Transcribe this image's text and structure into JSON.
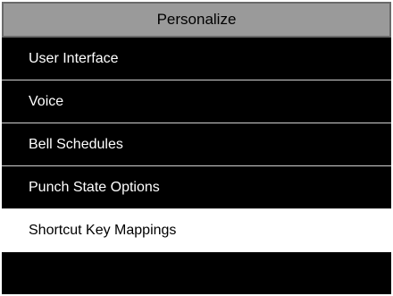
{
  "header": {
    "title": "Personalize"
  },
  "menu": {
    "items": [
      {
        "label": "User Interface"
      },
      {
        "label": "Voice"
      },
      {
        "label": "Bell Schedules"
      },
      {
        "label": "Punch State Options"
      },
      {
        "label": "Shortcut Key Mappings",
        "selected": true
      }
    ]
  },
  "colors": {
    "background": "#000000",
    "title_bar": "#9a9a9a",
    "item_text": "#ffffff",
    "selected_background": "#ffffff",
    "selected_text": "#000000"
  }
}
